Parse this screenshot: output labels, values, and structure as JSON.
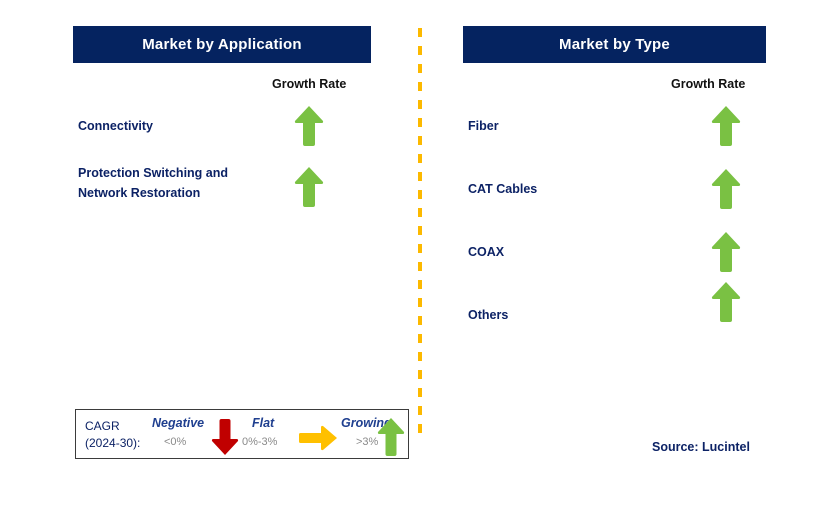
{
  "colors": {
    "header_bg": "#052360",
    "header_text": "#ffffff",
    "label_text": "#0c2265",
    "growing_arrow": "#7ac143",
    "flat_arrow": "#ffc000",
    "negative_arrow": "#c00000",
    "divider": "#fcb900",
    "legend_border": "#3b3b3b"
  },
  "panels": [
    {
      "id": "market-by-application",
      "title": "Market by Application",
      "column_header": "Growth Rate",
      "rows": [
        {
          "label": "Connectivity",
          "trend": "growing",
          "icon": "up-arrow-icon"
        },
        {
          "label": "Protection Switching and Network Restoration",
          "trend": "growing",
          "icon": "up-arrow-icon"
        }
      ]
    },
    {
      "id": "market-by-type",
      "title": "Market by Type",
      "column_header": "Growth Rate",
      "rows": [
        {
          "label": "Fiber",
          "trend": "growing",
          "icon": "up-arrow-icon"
        },
        {
          "label": "CAT Cables",
          "trend": "growing",
          "icon": "up-arrow-icon"
        },
        {
          "label": "COAX",
          "trend": "growing",
          "icon": "up-arrow-icon"
        },
        {
          "label": "Others",
          "trend": "growing",
          "icon": "up-arrow-icon"
        }
      ]
    }
  ],
  "legend": {
    "cagr_line1": "CAGR",
    "cagr_line2": "(2024-30):",
    "items": [
      {
        "title": "Negative",
        "range": "<0%",
        "icon": "down-arrow-icon",
        "color": "#c00000"
      },
      {
        "title": "Flat",
        "range": "0%-3%",
        "icon": "right-arrow-icon",
        "color": "#ffc000"
      },
      {
        "title": "Growing",
        "range": ">3%",
        "icon": "up-arrow-icon",
        "color": "#7ac143"
      }
    ]
  },
  "source": "Source: Lucintel"
}
